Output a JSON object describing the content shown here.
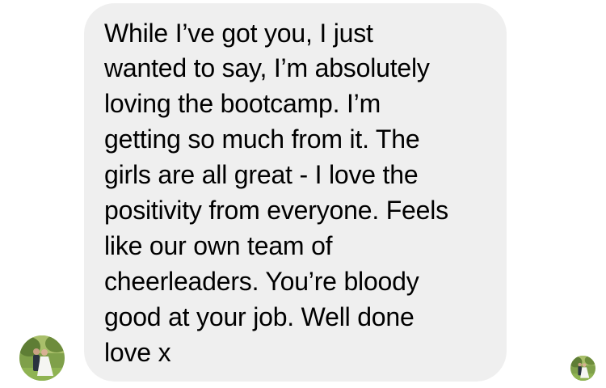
{
  "message": {
    "lines": [
      "While I’ve got you, I just",
      "wanted to say, I’m absolutely",
      "loving the bootcamp. I’m",
      "getting so much from it. The",
      "girls are all great - I love the",
      "positivity from everyone. Feels",
      "like our own team of",
      "cheerleaders. You’re bloody",
      "good at your job. Well done",
      "love x"
    ],
    "bubble_color": "#efefef",
    "text_color": "#000000"
  },
  "avatars": {
    "sender": {
      "icon": "wedding-photo-avatar"
    },
    "read_receipt": {
      "icon": "wedding-photo-avatar"
    }
  }
}
